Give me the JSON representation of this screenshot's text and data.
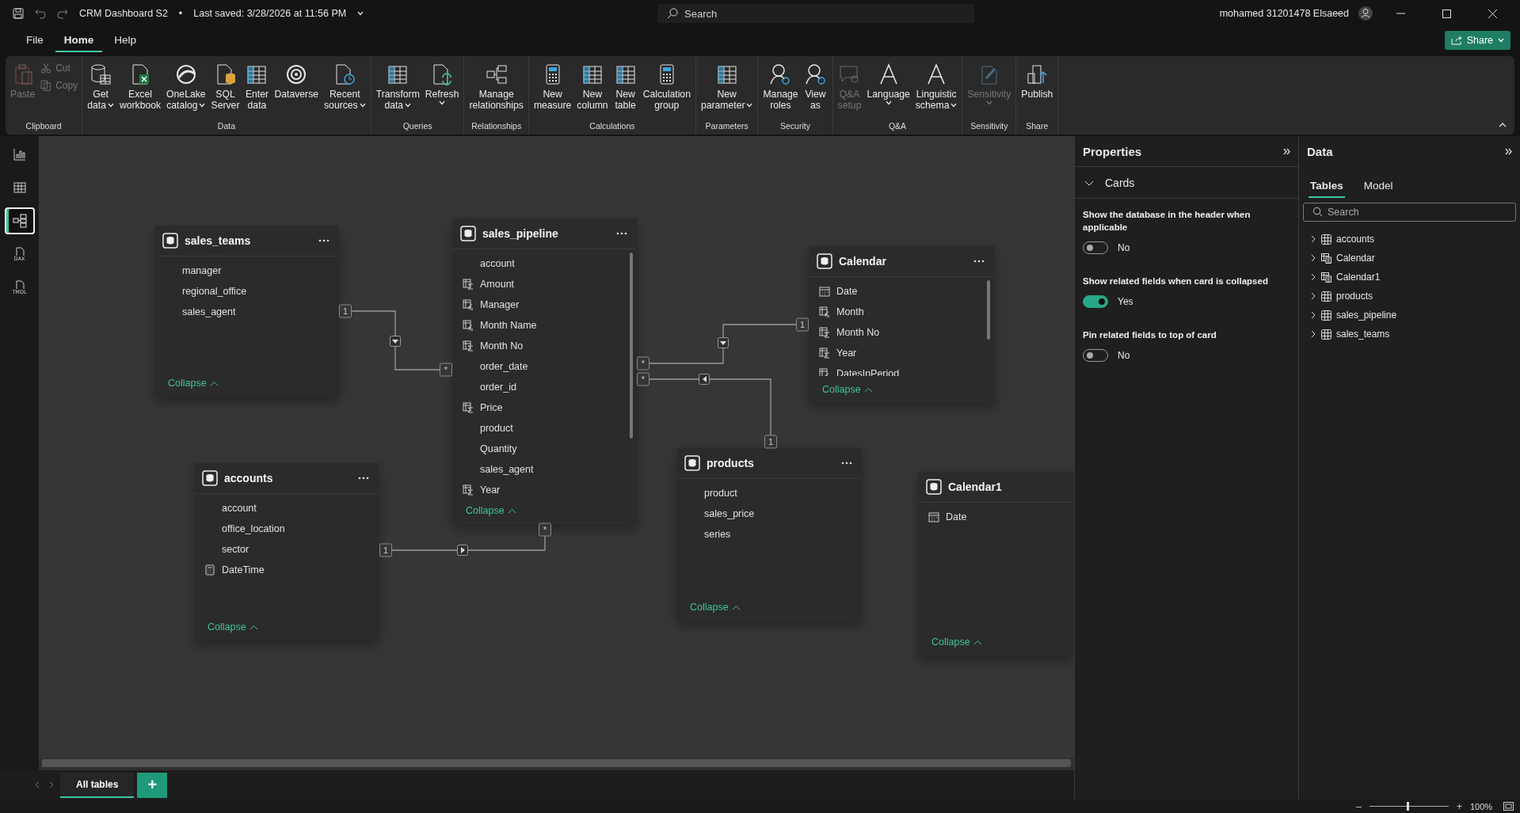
{
  "titlebar": {
    "title": "CRM Dashboard S2",
    "separator": "•",
    "saved": "Last saved: 3/28/2026 at 11:56 PM",
    "search": {
      "placeholder": "Search"
    },
    "user": "mohamed 31201478 Elsaeed"
  },
  "menu": [
    {
      "label": "File",
      "selected": false
    },
    {
      "label": "Home",
      "selected": true
    },
    {
      "label": "Help",
      "selected": false
    }
  ],
  "share": "Share",
  "ribbon": [
    {
      "label": "Clipboard",
      "buttons": [
        {
          "kind": "large",
          "lines": [
            "Paste"
          ],
          "disabled": true
        },
        {
          "kind": "small",
          "lines": [
            "Cut"
          ],
          "disabled": true
        },
        {
          "kind": "small",
          "lines": [
            "Copy"
          ],
          "disabled": true
        }
      ]
    },
    {
      "label": "Data",
      "buttons": [
        {
          "kind": "large",
          "lines": [
            "Get",
            "data"
          ],
          "dropdown": true,
          "disabled": false
        },
        {
          "kind": "large",
          "lines": [
            "Excel",
            "workbook"
          ],
          "disabled": false
        },
        {
          "kind": "large",
          "lines": [
            "OneLake",
            "catalog"
          ],
          "dropdown": true,
          "disabled": false
        },
        {
          "kind": "large",
          "lines": [
            "SQL",
            "Server"
          ],
          "disabled": false
        },
        {
          "kind": "large",
          "lines": [
            "Enter",
            "data"
          ],
          "disabled": false
        },
        {
          "kind": "large",
          "lines": [
            "Dataverse"
          ],
          "disabled": false
        },
        {
          "kind": "large",
          "lines": [
            "Recent",
            "sources"
          ],
          "dropdown": true,
          "disabled": false
        }
      ]
    },
    {
      "label": "Queries",
      "buttons": [
        {
          "kind": "large",
          "lines": [
            "Transform",
            "data"
          ],
          "dropdown": true,
          "disabled": false
        },
        {
          "kind": "large",
          "lines": [
            "Refresh"
          ],
          "dropdown": true,
          "disabled": false
        }
      ]
    },
    {
      "label": "Relationships",
      "buttons": [
        {
          "kind": "large",
          "lines": [
            "Manage",
            "relationships"
          ],
          "disabled": false
        }
      ]
    },
    {
      "label": "Calculations",
      "buttons": [
        {
          "kind": "large",
          "lines": [
            "New",
            "measure"
          ],
          "disabled": false
        },
        {
          "kind": "large",
          "lines": [
            "New",
            "column"
          ],
          "disabled": false
        },
        {
          "kind": "large",
          "lines": [
            "New",
            "table"
          ],
          "disabled": false
        },
        {
          "kind": "large",
          "lines": [
            "Calculation",
            "group"
          ],
          "disabled": false
        }
      ]
    },
    {
      "label": "Parameters",
      "buttons": [
        {
          "kind": "large",
          "lines": [
            "New",
            "parameter"
          ],
          "dropdown": true,
          "disabled": false
        }
      ]
    },
    {
      "label": "Security",
      "buttons": [
        {
          "kind": "large",
          "lines": [
            "Manage",
            "roles"
          ],
          "disabled": false
        },
        {
          "kind": "large",
          "lines": [
            "View",
            "as"
          ],
          "disabled": false
        }
      ]
    },
    {
      "label": "Q&A",
      "buttons": [
        {
          "kind": "large",
          "lines": [
            "Q&A",
            "setup"
          ],
          "disabled": true
        },
        {
          "kind": "large",
          "lines": [
            "Language"
          ],
          "dropdown": true,
          "disabled": false
        },
        {
          "kind": "large",
          "lines": [
            "Linguistic",
            "schema"
          ],
          "dropdown": true,
          "disabled": false
        }
      ]
    },
    {
      "label": "Sensitivity",
      "buttons": [
        {
          "kind": "large",
          "lines": [
            "Sensitivity"
          ],
          "dropdown": true,
          "disabled": true
        }
      ]
    },
    {
      "label": "Share",
      "buttons": [
        {
          "kind": "large",
          "lines": [
            "Publish"
          ],
          "disabled": false
        }
      ]
    }
  ],
  "views": [
    {
      "kind": "report",
      "selected": false
    },
    {
      "kind": "table",
      "selected": false
    },
    {
      "kind": "model",
      "selected": true
    },
    {
      "kind": "dax",
      "label": "DAX",
      "selected": false
    },
    {
      "kind": "tmdl",
      "label": "TMDL",
      "selected": false
    }
  ],
  "tables": [
    {
      "name": "sales_teams",
      "collapse": "Collapse",
      "fields": [
        {
          "name": "manager",
          "kind": "plain"
        },
        {
          "name": "regional_office",
          "kind": "plain"
        },
        {
          "name": "sales_agent",
          "kind": "plain"
        }
      ]
    },
    {
      "name": "sales_pipeline",
      "collapse": "Collapse",
      "fields": [
        {
          "name": "account",
          "kind": "plain"
        },
        {
          "name": "Amount",
          "kind": "sum"
        },
        {
          "name": "Manager",
          "kind": "calc"
        },
        {
          "name": "Month Name",
          "kind": "calc"
        },
        {
          "name": "Month No",
          "kind": "sum"
        },
        {
          "name": "order_date",
          "kind": "plain"
        },
        {
          "name": "order_id",
          "kind": "plain"
        },
        {
          "name": "Price",
          "kind": "sum"
        },
        {
          "name": "product",
          "kind": "plain"
        },
        {
          "name": "Quantity",
          "kind": "plain"
        },
        {
          "name": "sales_agent",
          "kind": "plain"
        },
        {
          "name": "Year",
          "kind": "sum"
        }
      ]
    },
    {
      "name": "Calendar",
      "collapse": "Collapse",
      "fields": [
        {
          "name": "Date",
          "kind": "date"
        },
        {
          "name": "Month",
          "kind": "calc"
        },
        {
          "name": "Month No",
          "kind": "sum"
        },
        {
          "name": "Year",
          "kind": "sum"
        },
        {
          "name": "DatesInPeriod",
          "kind": "calc"
        }
      ]
    },
    {
      "name": "accounts",
      "collapse": "Collapse",
      "fields": [
        {
          "name": "account",
          "kind": "plain"
        },
        {
          "name": "office_location",
          "kind": "plain"
        },
        {
          "name": "sector",
          "kind": "plain"
        },
        {
          "name": "DateTime",
          "kind": "calculator"
        }
      ]
    },
    {
      "name": "products",
      "collapse": "Collapse",
      "fields": [
        {
          "name": "product",
          "kind": "plain"
        },
        {
          "name": "sales_price",
          "kind": "plain"
        },
        {
          "name": "series",
          "kind": "plain"
        }
      ]
    },
    {
      "name": "Calendar1",
      "collapse": "Collapse",
      "fields": [
        {
          "name": "Date",
          "kind": "date"
        }
      ]
    }
  ],
  "relationships": [
    {
      "one_label": "1",
      "many_label": "*",
      "both_directions": false
    },
    {
      "one_label": "1",
      "many_label": "*",
      "both_directions": false
    },
    {
      "one_label": "1",
      "many_label": "*",
      "both_directions": false
    },
    {
      "one_label": "1",
      "many_label": "*",
      "both_directions": false
    }
  ],
  "page_tabs": [
    {
      "label": "All tables",
      "selected": true
    }
  ],
  "add_tab": "+",
  "properties": {
    "title": "Properties",
    "section": {
      "title": "Cards",
      "expanded": true
    },
    "options": [
      {
        "label": "Show the database in the header when applicable",
        "on": false,
        "value": "No"
      },
      {
        "label": "Show related fields when card is collapsed",
        "on": true,
        "value": "Yes"
      },
      {
        "label": "Pin related fields to top of card",
        "on": false,
        "value": "No"
      }
    ]
  },
  "data_panel": {
    "title": "Data",
    "tabs": [
      {
        "label": "Tables",
        "selected": true
      },
      {
        "label": "Model",
        "selected": false
      }
    ],
    "search": {
      "placeholder": "Search"
    },
    "tables": [
      {
        "name": "accounts",
        "kind": "table",
        "expanded": false
      },
      {
        "name": "Calendar",
        "kind": "calc_table",
        "expanded": false
      },
      {
        "name": "Calendar1",
        "kind": "calc_table",
        "expanded": false
      },
      {
        "name": "products",
        "kind": "table",
        "expanded": false
      },
      {
        "name": "sales_pipeline",
        "kind": "table",
        "expanded": false
      },
      {
        "name": "sales_teams",
        "kind": "table",
        "expanded": false
      }
    ]
  },
  "status": {
    "zoom_out": "–",
    "zoom_in": "+",
    "zoom": {
      "level": 0.49
    },
    "reading": "100%"
  }
}
